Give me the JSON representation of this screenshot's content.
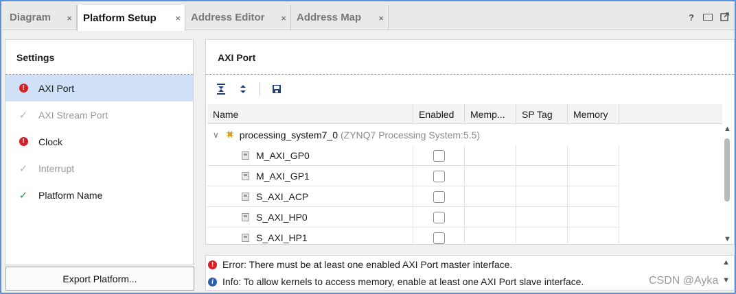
{
  "tabs": [
    {
      "label": "Diagram",
      "close": "×"
    },
    {
      "label": "Platform Setup",
      "close": "×"
    },
    {
      "label": "Address Editor",
      "close": "×"
    },
    {
      "label": "Address Map",
      "close": "×"
    }
  ],
  "window_controls": {
    "help": "?"
  },
  "settings": {
    "title": "Settings",
    "items": [
      {
        "label": "AXI Port",
        "status": "error"
      },
      {
        "label": "AXI Stream Port",
        "status": "disabled-check"
      },
      {
        "label": "Clock",
        "status": "error"
      },
      {
        "label": "Interrupt",
        "status": "disabled-check"
      },
      {
        "label": "Platform Name",
        "status": "ok-check"
      }
    ],
    "export_button": "Export Platform..."
  },
  "axi_port": {
    "title": "AXI Port",
    "toolbar": [
      "collapse-all-icon",
      "expand-all-icon",
      "save-icon"
    ],
    "columns": {
      "name": "Name",
      "enabled": "Enabled",
      "memport": "Memp...",
      "sptag": "SP Tag",
      "memory": "Memory"
    },
    "parent": {
      "name": "processing_system7_0",
      "desc": "(ZYNQ7 Processing System:5.5)",
      "expanded": true
    },
    "rows": [
      {
        "name": "M_AXI_GP0",
        "enabled": false
      },
      {
        "name": "M_AXI_GP1",
        "enabled": false
      },
      {
        "name": "S_AXI_ACP",
        "enabled": false
      },
      {
        "name": "S_AXI_HP0",
        "enabled": false
      },
      {
        "name": "S_AXI_HP1",
        "enabled": false
      }
    ]
  },
  "messages": [
    {
      "type": "error",
      "text": "Error: There must be at least one enabled AXI Port master interface."
    },
    {
      "type": "info",
      "text": "Info: To allow kernels to access memory, enable at least one AXI Port slave interface."
    }
  ],
  "watermark": "CSDN @Ayka",
  "colors": {
    "accent_border": "#5b8fd6",
    "selected_row": "#cfe0f7",
    "error": "#d81f26",
    "ok": "#2f9e44",
    "info": "#2f5fa8"
  }
}
